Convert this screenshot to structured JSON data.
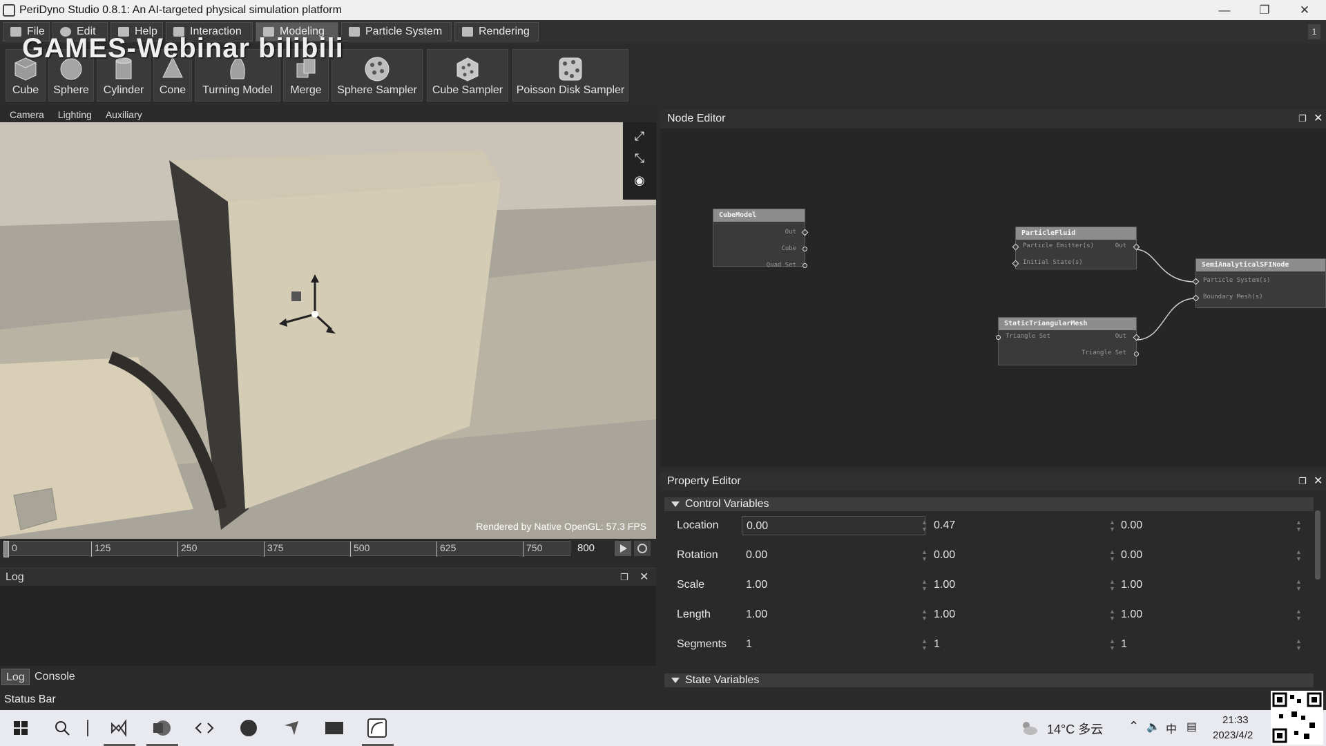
{
  "window": {
    "title": "PeriDyno Studio 0.8.1:  An AI-targeted physical simulation platform"
  },
  "menu": {
    "tabs": [
      {
        "label": "File"
      },
      {
        "label": "Edit"
      },
      {
        "label": "Help"
      },
      {
        "label": "Interaction"
      },
      {
        "label": "Modeling"
      },
      {
        "label": "Particle System"
      },
      {
        "label": "Rendering"
      }
    ],
    "active": "Modeling"
  },
  "watermark": "GAMES-Webinar bilibili",
  "toolbar": {
    "items": [
      {
        "label": "Cube"
      },
      {
        "label": "Sphere"
      },
      {
        "label": "Cylinder"
      },
      {
        "label": "Cone"
      },
      {
        "label": "Turning Model"
      },
      {
        "label": "Merge"
      },
      {
        "label": "Sphere Sampler"
      },
      {
        "label": "Cube Sampler"
      },
      {
        "label": "Poisson Disk Sampler"
      }
    ]
  },
  "viewport": {
    "tabs": [
      "Camera",
      "Lighting",
      "Auxiliary"
    ],
    "fps_text": "Rendered by Native OpenGL: 57.3 FPS"
  },
  "timeline": {
    "ticks": [
      "0",
      "125",
      "250",
      "375",
      "500",
      "625",
      "750"
    ],
    "end_frame": "800"
  },
  "log": {
    "title": "Log",
    "tabs": [
      "Log",
      "Console"
    ]
  },
  "status_bar": "Status Bar",
  "node_editor": {
    "title": "Node Editor",
    "nodes": {
      "cube": {
        "title": "CubeModel",
        "ports": [
          "Out",
          "Cube",
          "Quad Set"
        ]
      },
      "fluid": {
        "title": "ParticleFluid",
        "in_ports": [
          "Particle Emitter(s)",
          "Initial State(s)"
        ],
        "out_port": "Out"
      },
      "mesh": {
        "title": "StaticTriangularMesh",
        "in_ports": [
          "Triangle Set"
        ],
        "out_port": "Out",
        "extra_port": "Triangle Set"
      },
      "sfi": {
        "title": "SemiAnalyticalSFINode",
        "in_ports": [
          "Particle System(s)",
          "Boundary Mesh(s)"
        ]
      }
    }
  },
  "property_editor": {
    "title": "Property Editor",
    "section_control": "Control Variables",
    "section_state": "State Variables",
    "rows": [
      {
        "label": "Location",
        "values": [
          "0.00",
          "0.47",
          "0.00"
        ]
      },
      {
        "label": "Rotation",
        "values": [
          "0.00",
          "0.00",
          "0.00"
        ]
      },
      {
        "label": "Scale",
        "values": [
          "1.00",
          "1.00",
          "1.00"
        ]
      },
      {
        "label": "Length",
        "values": [
          "1.00",
          "1.00",
          "1.00"
        ]
      },
      {
        "label": "Segments",
        "values": [
          "1",
          "1",
          "1"
        ]
      }
    ]
  },
  "taskbar": {
    "weather": "14°C 多云",
    "time": "21:33",
    "date": "2023/4/2"
  }
}
